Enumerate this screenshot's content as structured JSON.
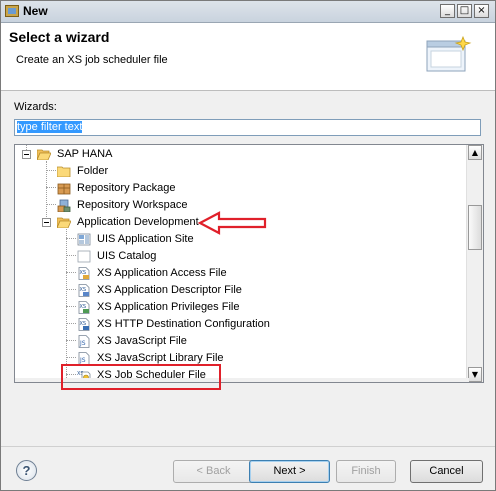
{
  "window": {
    "title": "New",
    "buttons": {
      "minimize": "_",
      "maximize": "□",
      "close": "×"
    }
  },
  "banner": {
    "title": "Select a wizard",
    "description": "Create an XS job scheduler file",
    "icon": "wizard-banner-icon"
  },
  "wizards": {
    "label": "Wizards:",
    "filter_value": "type filter text"
  },
  "tree": {
    "items": [
      {
        "label": "SAP HANA",
        "icon": "folder-open-icon",
        "expanded": true,
        "level": 0
      },
      {
        "label": "Folder",
        "icon": "folder-icon",
        "level": 1
      },
      {
        "label": "Repository Package",
        "icon": "package-icon",
        "level": 1
      },
      {
        "label": "Repository Workspace",
        "icon": "workspace-icon",
        "level": 1
      },
      {
        "label": "Application Development",
        "icon": "folder-open-icon",
        "expanded": true,
        "level": 1
      },
      {
        "label": "UIS Application Site",
        "icon": "uis-site-icon",
        "level": 2
      },
      {
        "label": "UIS Catalog",
        "icon": "uis-catalog-icon",
        "level": 2
      },
      {
        "label": "XS Application Access File",
        "icon": "xs-file-icon",
        "level": 2
      },
      {
        "label": "XS Application Descriptor File",
        "icon": "xs-file-icon",
        "level": 2
      },
      {
        "label": "XS Application Privileges File",
        "icon": "xs-file-icon",
        "level": 2
      },
      {
        "label": "XS HTTP Destination Configuration",
        "icon": "xs-file-icon",
        "level": 2
      },
      {
        "label": "XS JavaScript File",
        "icon": "js-file-icon",
        "level": 2
      },
      {
        "label": "XS JavaScript Library File",
        "icon": "js-file-icon",
        "level": 2
      },
      {
        "label": "XS Job Scheduler File",
        "icon": "xs-job-icon",
        "level": 2
      }
    ]
  },
  "annotations": {
    "arrow_color": "#e0202a",
    "box_color": "#e0202a"
  },
  "footer": {
    "help": "?",
    "back": "< Back",
    "next": "Next >",
    "finish": "Finish",
    "cancel": "Cancel"
  }
}
